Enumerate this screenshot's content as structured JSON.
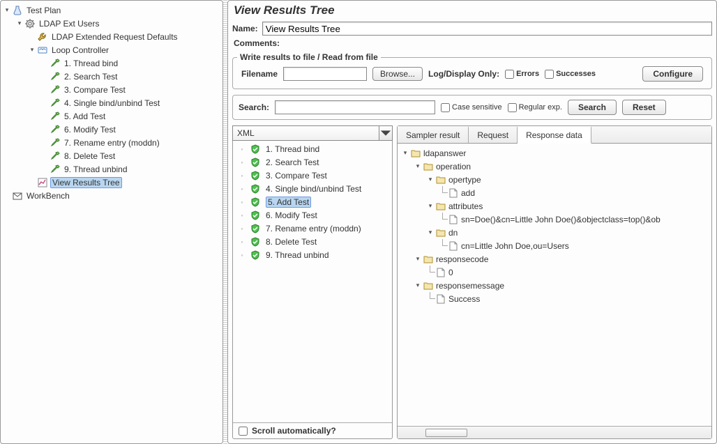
{
  "left_tree": {
    "items": [
      {
        "depth": 0,
        "toggle": "open",
        "icon": "flask",
        "label": "Test Plan",
        "selected": false
      },
      {
        "depth": 1,
        "toggle": "open",
        "icon": "gear",
        "label": "LDAP Ext Users",
        "selected": false
      },
      {
        "depth": 2,
        "toggle": "none",
        "icon": "wrench",
        "label": "LDAP Extended Request Defaults",
        "selected": false
      },
      {
        "depth": 2,
        "toggle": "open",
        "icon": "loop",
        "label": "Loop Controller",
        "selected": false
      },
      {
        "depth": 3,
        "toggle": "none",
        "icon": "pipette",
        "label": "1. Thread bind",
        "selected": false
      },
      {
        "depth": 3,
        "toggle": "none",
        "icon": "pipette",
        "label": "2. Search Test",
        "selected": false
      },
      {
        "depth": 3,
        "toggle": "none",
        "icon": "pipette",
        "label": "3. Compare Test",
        "selected": false
      },
      {
        "depth": 3,
        "toggle": "none",
        "icon": "pipette",
        "label": "4. Single bind/unbind Test",
        "selected": false
      },
      {
        "depth": 3,
        "toggle": "none",
        "icon": "pipette",
        "label": "5. Add Test",
        "selected": false
      },
      {
        "depth": 3,
        "toggle": "none",
        "icon": "pipette",
        "label": "6. Modify Test",
        "selected": false
      },
      {
        "depth": 3,
        "toggle": "none",
        "icon": "pipette",
        "label": "7. Rename entry (moddn)",
        "selected": false
      },
      {
        "depth": 3,
        "toggle": "none",
        "icon": "pipette",
        "label": "8. Delete Test",
        "selected": false
      },
      {
        "depth": 3,
        "toggle": "none",
        "icon": "pipette",
        "label": "9. Thread unbind",
        "selected": false
      },
      {
        "depth": 2,
        "toggle": "none",
        "icon": "chart",
        "label": "View Results Tree",
        "selected": true
      },
      {
        "depth": 0,
        "toggle": "none",
        "icon": "workbench",
        "label": "WorkBench",
        "selected": false
      }
    ]
  },
  "panel": {
    "title": "View Results Tree",
    "name_label": "Name:",
    "name_value": "View Results Tree",
    "comments_label": "Comments:",
    "file_group_title": "Write results to file / Read from file",
    "filename_label": "Filename",
    "filename_value": "",
    "browse_label": "Browse...",
    "logdisplay_label": "Log/Display Only:",
    "errors_label": "Errors",
    "successes_label": "Successes",
    "configure_label": "Configure",
    "search_label": "Search:",
    "search_value": "",
    "case_sensitive_label": "Case sensitive",
    "regex_label": "Regular exp.",
    "search_btn": "Search",
    "reset_btn": "Reset",
    "renderer_value": "XML",
    "results": [
      {
        "label": "1. Thread bind",
        "selected": false
      },
      {
        "label": "2. Search Test",
        "selected": false
      },
      {
        "label": "3. Compare Test",
        "selected": false
      },
      {
        "label": "4. Single bind/unbind Test",
        "selected": false
      },
      {
        "label": "5. Add Test",
        "selected": true
      },
      {
        "label": "6. Modify Test",
        "selected": false
      },
      {
        "label": "7. Rename entry (moddn)",
        "selected": false
      },
      {
        "label": "8. Delete Test",
        "selected": false
      },
      {
        "label": "9. Thread unbind",
        "selected": false
      }
    ],
    "scroll_auto_label": "Scroll automatically?",
    "tabs": {
      "sampler": "Sampler result",
      "request": "Request",
      "response": "Response data",
      "active": "response"
    },
    "response_tree": [
      {
        "depth": 0,
        "toggle": "open",
        "icon": "folder",
        "label": "ldapanswer"
      },
      {
        "depth": 1,
        "toggle": "open",
        "icon": "folder",
        "label": "operation"
      },
      {
        "depth": 2,
        "toggle": "open",
        "icon": "folder",
        "label": "opertype"
      },
      {
        "depth": 3,
        "toggle": "leaf",
        "icon": "file",
        "label": "add"
      },
      {
        "depth": 2,
        "toggle": "open",
        "icon": "folder",
        "label": "attributes"
      },
      {
        "depth": 3,
        "toggle": "leaf",
        "icon": "file",
        "label": "sn=Doe()&cn=Little John Doe()&objectclass=top()&ob"
      },
      {
        "depth": 2,
        "toggle": "open",
        "icon": "folder",
        "label": "dn"
      },
      {
        "depth": 3,
        "toggle": "leaf",
        "icon": "file",
        "label": "cn=Little John Doe,ou=Users"
      },
      {
        "depth": 1,
        "toggle": "open",
        "icon": "folder",
        "label": "responsecode"
      },
      {
        "depth": 2,
        "toggle": "leaf",
        "icon": "file",
        "label": "0"
      },
      {
        "depth": 1,
        "toggle": "open",
        "icon": "folder",
        "label": "responsemessage"
      },
      {
        "depth": 2,
        "toggle": "leaf",
        "icon": "file",
        "label": "Success"
      }
    ]
  }
}
